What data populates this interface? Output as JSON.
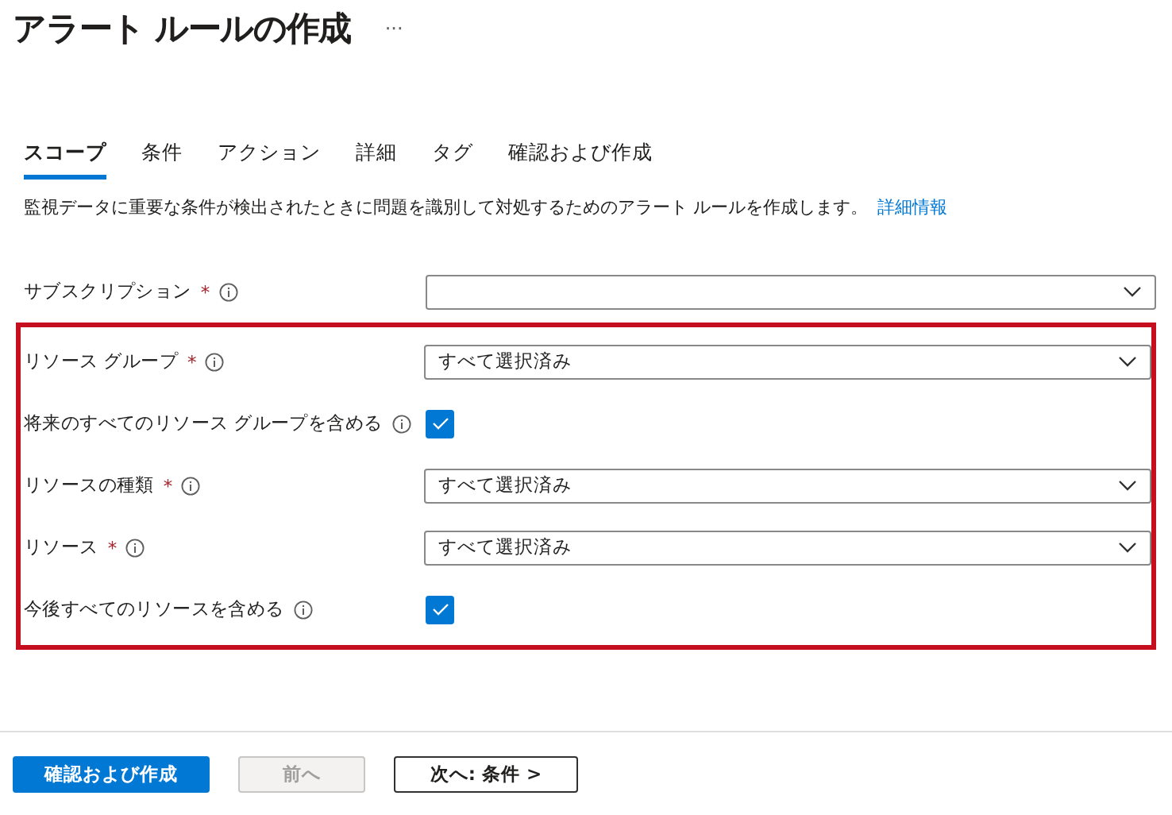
{
  "title": "アラート ルールの作成",
  "more": "···",
  "tabs": [
    {
      "label": "スコープ",
      "selected": true
    },
    {
      "label": "条件",
      "selected": false
    },
    {
      "label": "アクション",
      "selected": false
    },
    {
      "label": "詳細",
      "selected": false
    },
    {
      "label": "タグ",
      "selected": false
    },
    {
      "label": "確認および作成",
      "selected": false
    }
  ],
  "description": {
    "text": "監視データに重要な条件が検出されたときに問題を識別して対処するためのアラート ルールを作成します。",
    "link": "詳細情報"
  },
  "rows": [
    {
      "kind": "dropdown",
      "label": "サブスクリプション",
      "required_mark": "*"
    }
  ],
  "highlighted_rows": [
    {
      "kind": "dropdown",
      "label": "リソース グループ",
      "required_mark": "*",
      "value": "すべて選択済み"
    },
    {
      "kind": "checkbox",
      "label": "将来のすべてのリソース グループを含める",
      "checked": true
    },
    {
      "kind": "dropdown",
      "label": "リソースの種類",
      "required_mark": "*",
      "value": "すべて選択済み"
    },
    {
      "kind": "dropdown",
      "label": "リソース",
      "required_mark": "*",
      "value": "すべて選択済み"
    },
    {
      "kind": "checkbox",
      "label": "今後すべてのリソースを含める",
      "checked": true
    }
  ],
  "buttons": [
    {
      "label": "確認および作成",
      "kind": "primary",
      "disabled": false
    },
    {
      "label": "前へ",
      "kind": "secondary",
      "disabled": true
    },
    {
      "label": "次へ: 条件 >",
      "kind": "secondary",
      "disabled": false
    }
  ]
}
